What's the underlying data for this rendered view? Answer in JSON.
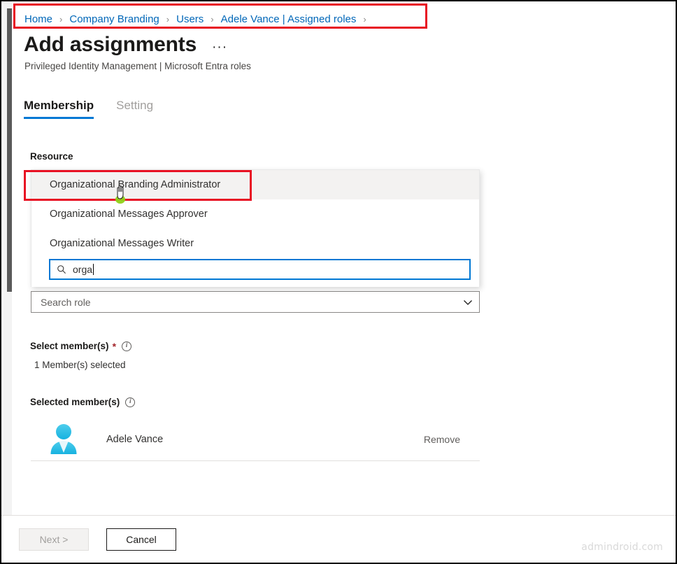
{
  "breadcrumb": {
    "items": [
      "Home",
      "Company Branding",
      "Users",
      "Adele Vance | Assigned roles"
    ],
    "separator": "›"
  },
  "header": {
    "title": "Add assignments",
    "ellipsis": "···",
    "subtitle": "Privileged Identity Management | Microsoft Entra roles"
  },
  "tabs": [
    {
      "label": "Membership",
      "active": true
    },
    {
      "label": "Setting",
      "active": false
    }
  ],
  "resource": {
    "label": "Resource",
    "dropdown_open": true,
    "options": [
      "Organizational Branding Administrator",
      "Organizational Messages Approver",
      "Organizational Messages Writer"
    ],
    "highlighted_option": "Organizational Branding Administrator",
    "search_value": "orga",
    "search_icon": "search-icon"
  },
  "role_combobox": {
    "placeholder": "Search role",
    "chevron_icon": "chevron-down-icon"
  },
  "select_members": {
    "label": "Select member(s)",
    "required_marker": "*",
    "info_icon": "info-icon",
    "info_glyph": "i",
    "count_text": "1 Member(s) selected"
  },
  "selected_members": {
    "label": "Selected member(s)",
    "info_icon": "info-icon",
    "info_glyph": "i",
    "rows": [
      {
        "name": "Adele Vance",
        "avatar_icon": "person-avatar-icon",
        "remove_label": "Remove"
      }
    ]
  },
  "footer": {
    "next_label": "Next >",
    "next_disabled": true,
    "cancel_label": "Cancel",
    "watermark": "admindroid.com"
  },
  "colors": {
    "link_blue": "#0067b8",
    "accent_blue": "#0078d4",
    "highlight_red": "#e81123",
    "avatar_cyan": "#30bfe8",
    "required_red": "#a4262c",
    "watermark_gray": "#d9d9d9"
  },
  "annotations": {
    "breadcrumb_highlight": "red-rectangle",
    "option_highlight": "red-rectangle",
    "cursor": "hand-pointer-cursor"
  }
}
